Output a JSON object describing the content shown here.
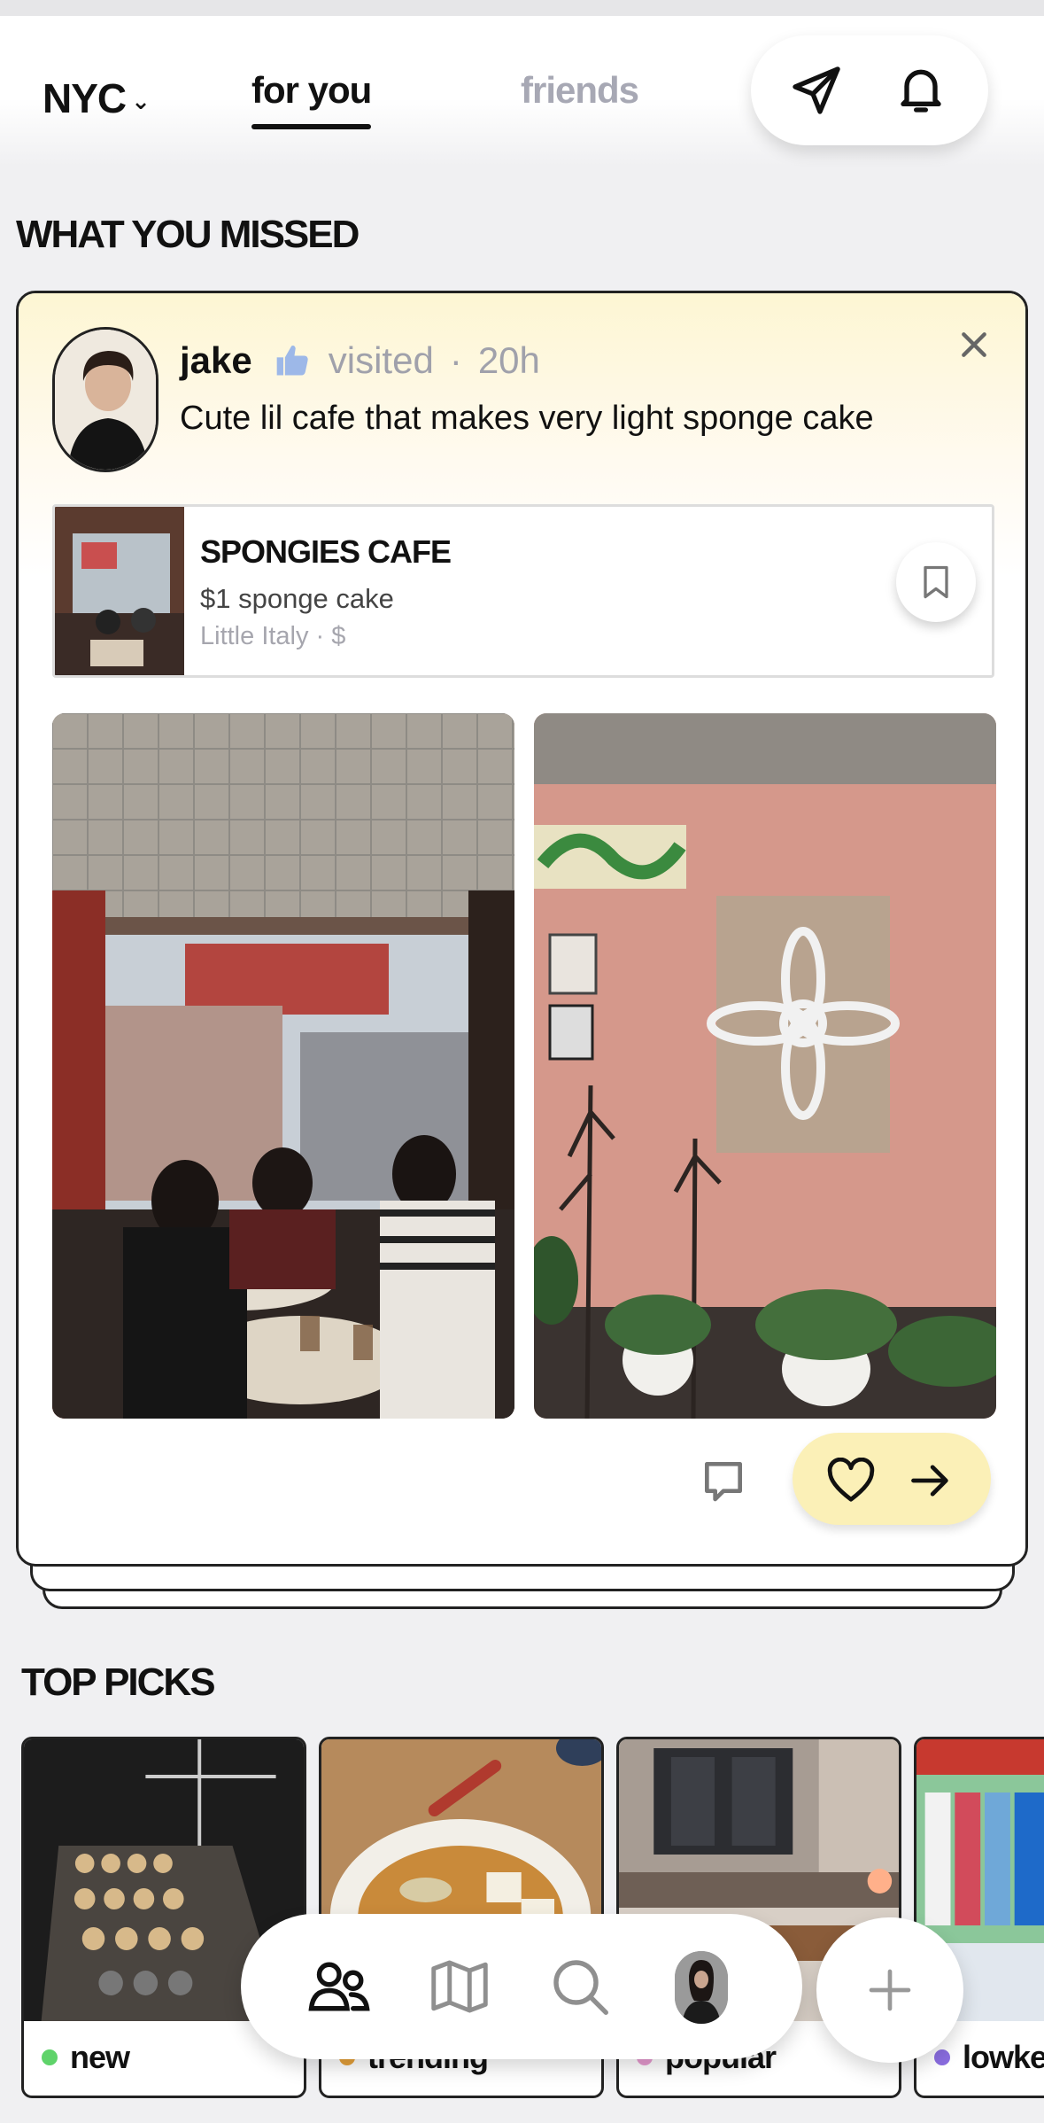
{
  "header": {
    "city": "NYC",
    "tabs": [
      {
        "label": "for you",
        "active": true
      },
      {
        "label": "friends",
        "active": false
      }
    ],
    "icons": [
      "send-icon",
      "bell-icon"
    ]
  },
  "missed": {
    "title": "WHAT YOU MISSED",
    "post": {
      "user": "jake",
      "verb": "visited",
      "separator": "·",
      "time": "20h",
      "text": "Cute lil cafe that makes very light sponge cake",
      "place": {
        "name": "SPONGIES CAFE",
        "deal": "$1 sponge cake",
        "meta": "Little Italy · $"
      }
    }
  },
  "top_picks": {
    "title": "TOP PICKS",
    "items": [
      {
        "label": "new",
        "dot_color": "#5fd36a"
      },
      {
        "label": "trending",
        "dot_color": "#e7a23b"
      },
      {
        "label": "popular",
        "dot_color": "#e79bd0"
      },
      {
        "label": "lowkey",
        "dot_color": "#8a6de0"
      }
    ]
  },
  "bottom_nav": {
    "items": [
      "friends-icon",
      "map-icon",
      "search-icon",
      "profile-avatar"
    ],
    "add": "plus-icon"
  },
  "colors": {
    "accent_yellow": "#fbf0b7",
    "muted_text": "#a0a1ab",
    "ink": "#111111"
  }
}
